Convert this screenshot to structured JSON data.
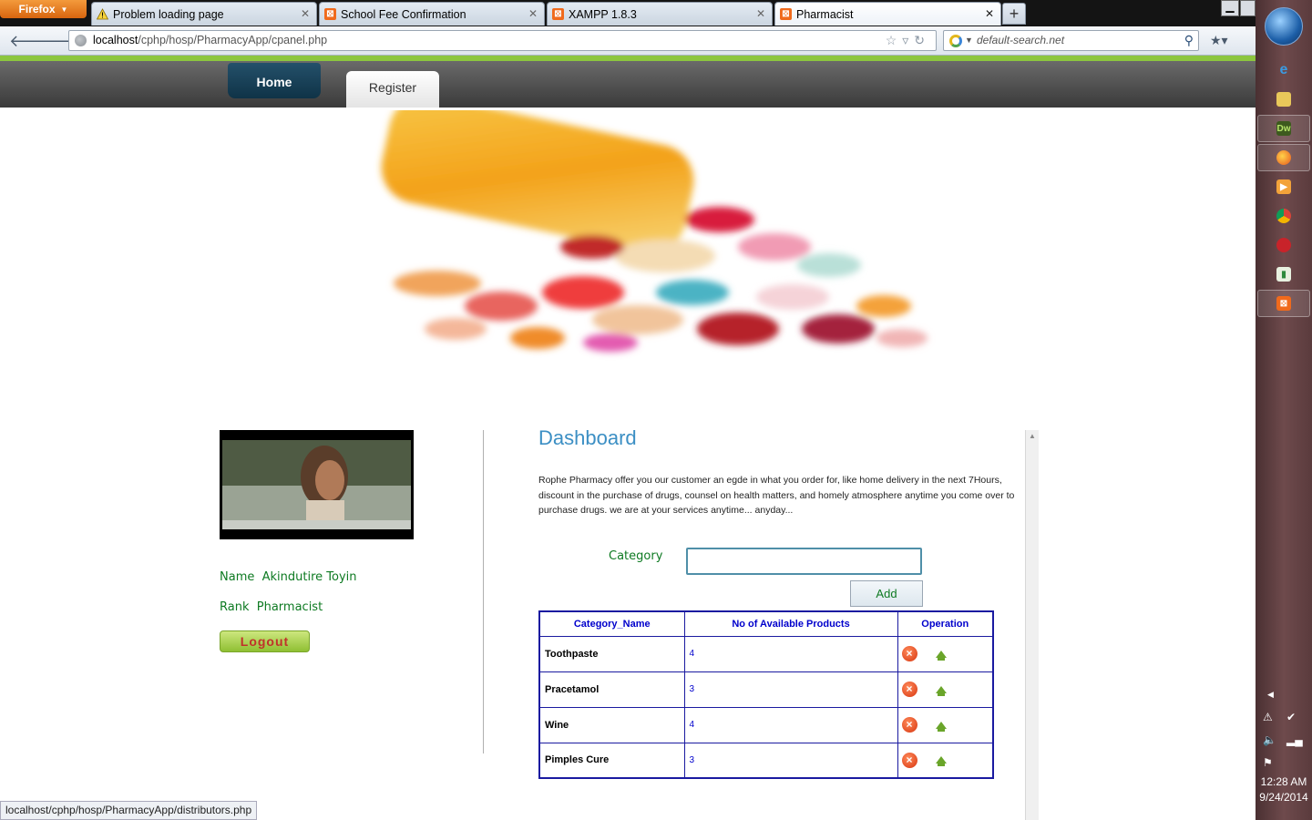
{
  "browser": {
    "menu_button": "Firefox",
    "tabs": [
      {
        "title": "Problem loading page",
        "icon": "warning-icon"
      },
      {
        "title": "School Fee Confirmation",
        "icon": "xampp-icon"
      },
      {
        "title": "XAMPP 1.8.3",
        "icon": "xampp-icon"
      },
      {
        "title": "Pharmacist",
        "icon": "xampp-icon",
        "active": true
      }
    ],
    "new_tab": "+",
    "url_host": "localhost",
    "url_path": "/cphp/hosp/PharmacyApp/cpanel.php",
    "search_text": "default-search.net",
    "status_url": "localhost/cphp/hosp/PharmacyApp/distributors.php"
  },
  "site_nav": {
    "home": "Home",
    "register": "Register"
  },
  "profile": {
    "name_label": "Name",
    "name_value": "Akindutire Toyin",
    "rank_label": "Rank",
    "rank_value": "Pharmacist",
    "logout": "Logout"
  },
  "dashboard": {
    "title": "Dashboard",
    "description": "Rophe Pharmacy offer you our customer an egde in what you order for, like home delivery in the next 7Hours, discount in the purchase of drugs, counsel on health matters, and homely atmosphere anytime you come over to purchase drugs. we are at your services anytime... anyday...",
    "category_label": "Category",
    "category_value": "",
    "add_button": "Add"
  },
  "table": {
    "headers": [
      "Category_Name",
      "No of Available Products",
      "Operation"
    ],
    "rows": [
      {
        "name": "Toothpaste",
        "count": "4"
      },
      {
        "name": "Pracetamol",
        "count": "3"
      },
      {
        "name": "Wine",
        "count": "4"
      },
      {
        "name": "Pimples Cure",
        "count": "3"
      }
    ]
  },
  "taskbar": {
    "time": "12:28 AM",
    "date": "9/24/2014"
  },
  "colors": {
    "accent_green": "#8cc63f",
    "title_blue": "#3c8fc4",
    "label_green": "#0e7a22",
    "table_border": "#1a1aa0"
  }
}
